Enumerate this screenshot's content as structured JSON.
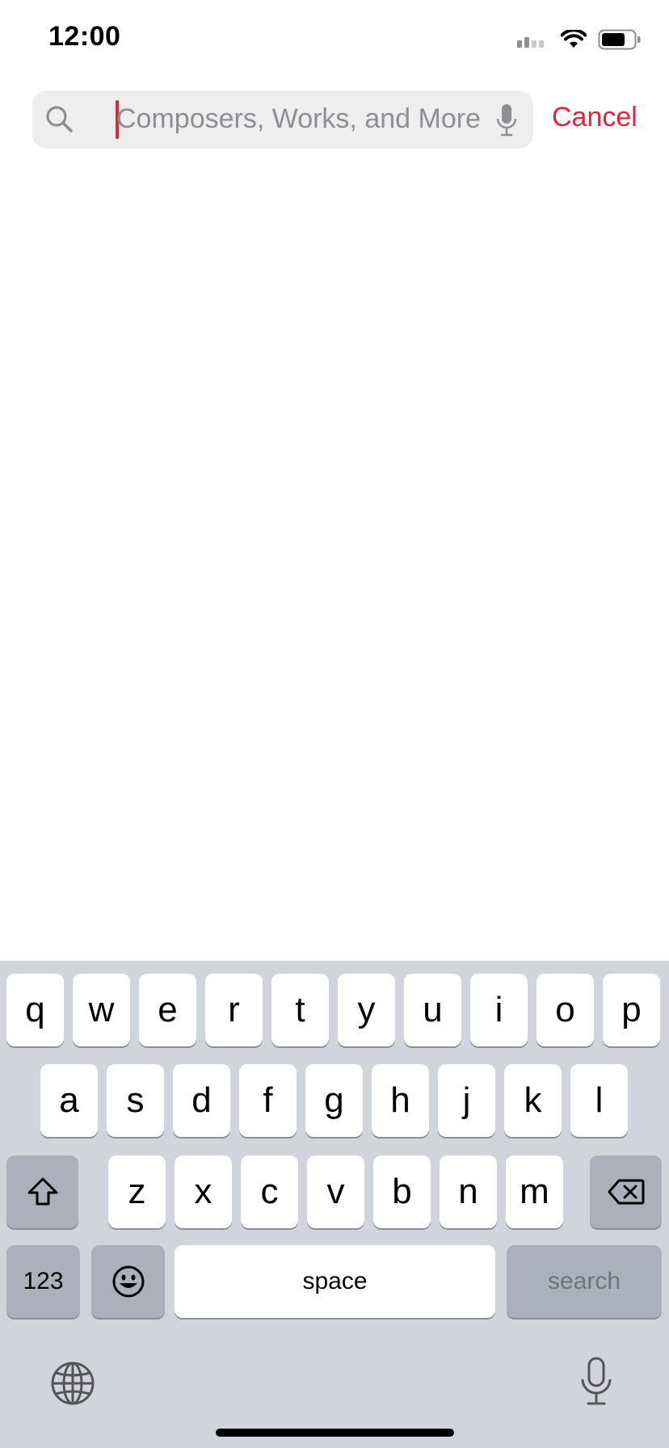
{
  "status_bar": {
    "time": "12:00",
    "signal_icon": "cellular-signal-icon",
    "wifi_icon": "wifi-icon",
    "battery_icon": "battery-icon"
  },
  "search": {
    "placeholder": "Composers, Works, and More",
    "value": "",
    "search_icon": "search-icon",
    "dictation_icon": "microphone-icon",
    "cancel_label": "Cancel"
  },
  "colors": {
    "accent": "#e0243d",
    "field_background": "#eeeeef",
    "keyboard_background": "#d1d4db",
    "dark_key": "#abb0bc"
  },
  "keyboard": {
    "row1": [
      "q",
      "w",
      "e",
      "r",
      "t",
      "y",
      "u",
      "i",
      "o",
      "p"
    ],
    "row2": [
      "a",
      "s",
      "d",
      "f",
      "g",
      "h",
      "j",
      "k",
      "l"
    ],
    "row3": [
      "z",
      "x",
      "c",
      "v",
      "b",
      "n",
      "m"
    ],
    "shift_icon": "shift-icon",
    "delete_icon": "delete-icon",
    "numbers_label": "123",
    "emoji_icon": "emoji-icon",
    "space_label": "space",
    "search_label": "search",
    "globe_icon": "globe-icon",
    "dictation_icon": "microphone-icon"
  }
}
